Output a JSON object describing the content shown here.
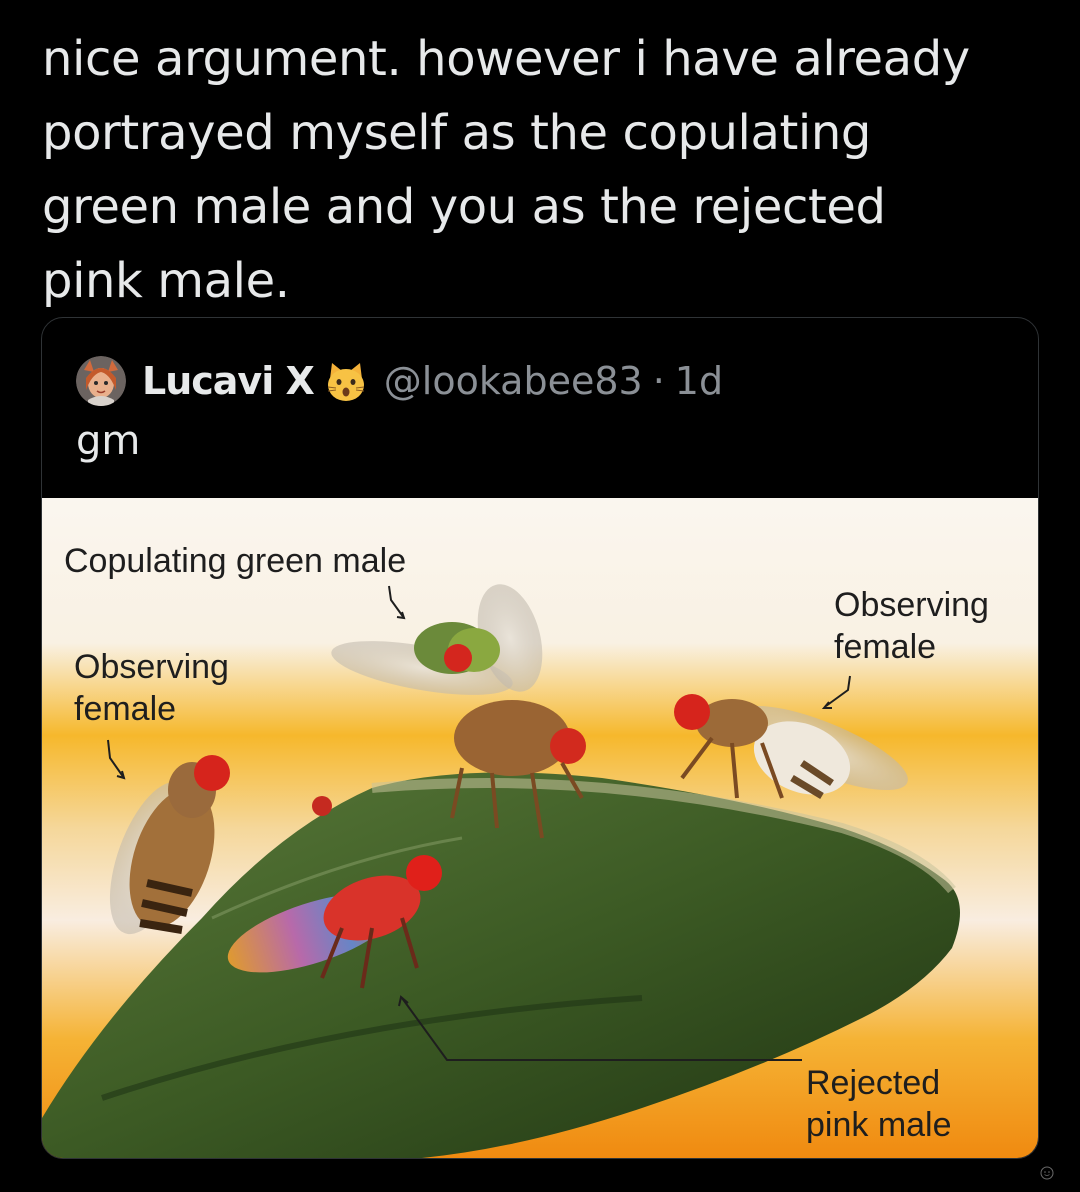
{
  "tweet": {
    "text_lines": [
      "nice argument. however i have already",
      "portrayed myself as the copulating",
      "green male and you as the rejected",
      "pink male."
    ]
  },
  "quote": {
    "display_name": "Lucavi X",
    "handle": "@lookabee83",
    "separator": "·",
    "time": "1d",
    "text": "gm",
    "avatar_icon": "avatar-icon",
    "badge_icon": "cat-emoji-icon"
  },
  "figure": {
    "labels": {
      "copulating_green_male": "Copulating green male",
      "observing_female_left_1": "Observing",
      "observing_female_left_2": "female",
      "observing_female_right_1": "Observing",
      "observing_female_right_2": "female",
      "rejected_pink_male_1": "Rejected",
      "rejected_pink_male_2": "pink male"
    }
  },
  "colors": {
    "background": "#000000",
    "text": "#e7e9ea",
    "muted": "#8b9096",
    "border": "#2f3336"
  }
}
